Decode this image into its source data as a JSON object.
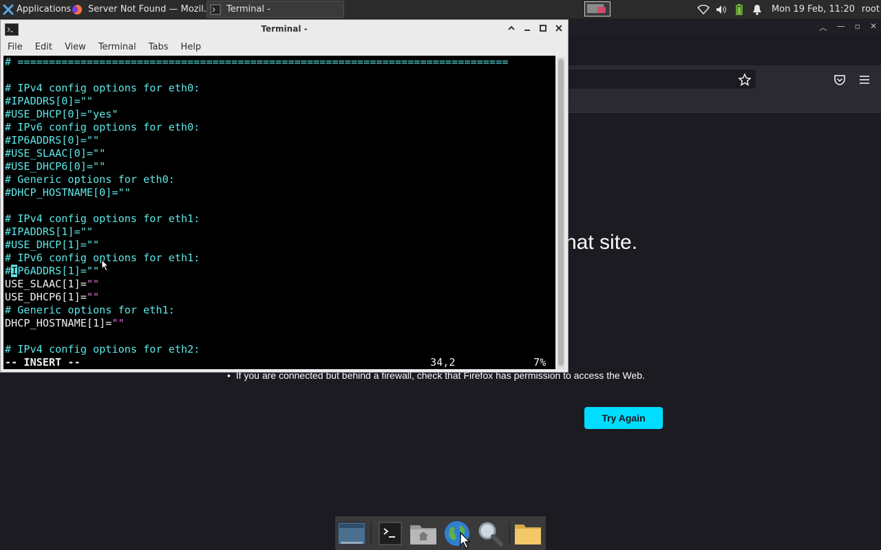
{
  "panel": {
    "applications_label": "Applications",
    "tasks": [
      {
        "label": "Server Not Found — Mozil..."
      },
      {
        "label": "Terminal -"
      }
    ],
    "clock": "Mon 19 Feb, 11:20",
    "user": "root"
  },
  "terminal": {
    "title": "Terminal -",
    "menu": [
      "File",
      "Edit",
      "View",
      "Terminal",
      "Tabs",
      "Help"
    ],
    "lines": [
      "# ==============================================================================",
      "",
      "# IPv4 config options for eth0:",
      "#IPADDRS[0]=\"\"",
      "#USE_DHCP[0]=\"yes\"",
      "# IPv6 config options for eth0:",
      "#IP6ADDRS[0]=\"\"",
      "#USE_SLAAC[0]=\"\"",
      "#USE_DHCP6[0]=\"\"",
      "# Generic options for eth0:",
      "#DHCP_HOSTNAME[0]=\"\"",
      "",
      "# IPv4 config options for eth1:",
      "#IPADDRS[1]=\"\"",
      "#USE_DHCP[1]=\"\"",
      "# IPv6 config options for eth1:"
    ],
    "edit_lines": [
      {
        "pre": "#",
        "cursor": "I",
        "rest": "P6ADDRS[1]=",
        "quote": "\"\""
      },
      {
        "pre": "",
        "cursor": "",
        "rest": "USE_SLAAC[1]=",
        "quote": "\"\""
      },
      {
        "pre": "",
        "cursor": "",
        "rest": "USE_DHCP6[1]=",
        "quote": "\"\""
      }
    ],
    "generic_line": "# Generic options for eth1:",
    "hostname_line": {
      "rest": "DHCP_HOSTNAME[1]=",
      "quote": "\"\""
    },
    "last_line": "# IPv4 config options for eth2:",
    "status": {
      "mode": "-- INSERT --",
      "position": "34,2",
      "percent": "7%"
    }
  },
  "firefox": {
    "error_title_fragment": "hat site.",
    "bullet_text": "If you are connected but behind a firewall, check that Firefox has permission to access the Web.",
    "try_again_label": "Try Again"
  },
  "colors": {
    "comment": "#5ee8e8",
    "text": "#f0f0f0",
    "string": "#e66fe6",
    "accent_button": "#00ddff"
  },
  "icons": {
    "dock": [
      "show-desktop-icon",
      "terminal-icon",
      "home-folder-icon",
      "web-browser-icon",
      "search-icon",
      "files-icon"
    ]
  }
}
